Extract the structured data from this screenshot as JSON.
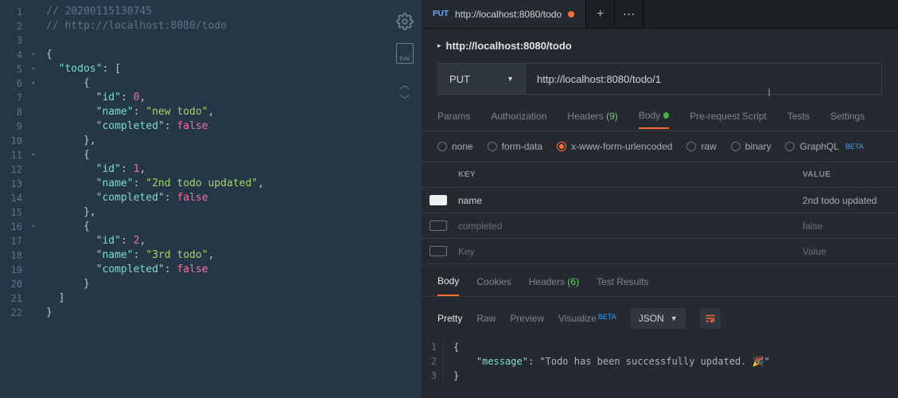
{
  "editor": {
    "line_count": 22,
    "fold_lines": [
      4,
      5,
      6,
      11,
      16
    ],
    "lines": {
      "l1_comment": "// 20200115130745",
      "l2_comment": "// http://localhost:8080/todo",
      "todos_key": "\"todos\"",
      "id_key": "\"id\"",
      "name_key": "\"name\"",
      "completed_key": "\"completed\"",
      "id_vals": [
        "0",
        "1",
        "2"
      ],
      "name_vals": [
        "\"new todo\"",
        "\"2nd todo updated\"",
        "\"3rd todo\""
      ],
      "completed_val": "false"
    }
  },
  "side_icons": {
    "raw_label": "RAW"
  },
  "tab": {
    "method": "PUT",
    "title": "http://localhost:8080/todo"
  },
  "breadcrumb": "http://localhost:8080/todo",
  "request": {
    "method": "PUT",
    "url": "http://localhost:8080/todo/1"
  },
  "req_tabs": {
    "params": "Params",
    "auth": "Authorization",
    "headers": "Headers",
    "headers_count": "(9)",
    "body": "Body",
    "prescript": "Pre-request Script",
    "tests": "Tests",
    "settings": "Settings"
  },
  "body_types": {
    "none": "none",
    "formdata": "form-data",
    "xwww": "x-www-form-urlencoded",
    "raw": "raw",
    "binary": "binary",
    "graphql": "GraphQL",
    "beta": "BETA"
  },
  "kv": {
    "head_key": "KEY",
    "head_val": "VALUE",
    "rows": [
      {
        "checked": true,
        "key": "name",
        "value": "2nd todo updated"
      },
      {
        "checked": false,
        "key": "completed",
        "value": "false"
      },
      {
        "checked": false,
        "key": "Key",
        "value": "Value"
      }
    ]
  },
  "resp_tabs": {
    "body": "Body",
    "cookies": "Cookies",
    "headers": "Headers",
    "headers_count": "(6)",
    "results": "Test Results"
  },
  "resp_bar": {
    "pretty": "Pretty",
    "raw": "Raw",
    "preview": "Preview",
    "visualize": "Visualize",
    "beta": "BETA",
    "fmt": "JSON"
  },
  "response_body": {
    "key": "\"message\"",
    "val": "\"Todo has been successfully updated. 🎉\""
  }
}
